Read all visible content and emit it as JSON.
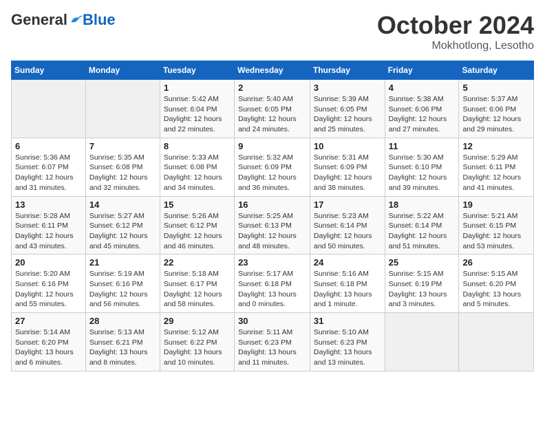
{
  "logo": {
    "general": "General",
    "blue": "Blue"
  },
  "header": {
    "month": "October 2024",
    "location": "Mokhotlong, Lesotho"
  },
  "weekdays": [
    "Sunday",
    "Monday",
    "Tuesday",
    "Wednesday",
    "Thursday",
    "Friday",
    "Saturday"
  ],
  "weeks": [
    [
      {
        "day": null
      },
      {
        "day": null
      },
      {
        "day": "1",
        "sunrise": "Sunrise: 5:42 AM",
        "sunset": "Sunset: 6:04 PM",
        "daylight": "Daylight: 12 hours and 22 minutes."
      },
      {
        "day": "2",
        "sunrise": "Sunrise: 5:40 AM",
        "sunset": "Sunset: 6:05 PM",
        "daylight": "Daylight: 12 hours and 24 minutes."
      },
      {
        "day": "3",
        "sunrise": "Sunrise: 5:39 AM",
        "sunset": "Sunset: 6:05 PM",
        "daylight": "Daylight: 12 hours and 25 minutes."
      },
      {
        "day": "4",
        "sunrise": "Sunrise: 5:38 AM",
        "sunset": "Sunset: 6:06 PM",
        "daylight": "Daylight: 12 hours and 27 minutes."
      },
      {
        "day": "5",
        "sunrise": "Sunrise: 5:37 AM",
        "sunset": "Sunset: 6:06 PM",
        "daylight": "Daylight: 12 hours and 29 minutes."
      }
    ],
    [
      {
        "day": "6",
        "sunrise": "Sunrise: 5:36 AM",
        "sunset": "Sunset: 6:07 PM",
        "daylight": "Daylight: 12 hours and 31 minutes."
      },
      {
        "day": "7",
        "sunrise": "Sunrise: 5:35 AM",
        "sunset": "Sunset: 6:08 PM",
        "daylight": "Daylight: 12 hours and 32 minutes."
      },
      {
        "day": "8",
        "sunrise": "Sunrise: 5:33 AM",
        "sunset": "Sunset: 6:08 PM",
        "daylight": "Daylight: 12 hours and 34 minutes."
      },
      {
        "day": "9",
        "sunrise": "Sunrise: 5:32 AM",
        "sunset": "Sunset: 6:09 PM",
        "daylight": "Daylight: 12 hours and 36 minutes."
      },
      {
        "day": "10",
        "sunrise": "Sunrise: 5:31 AM",
        "sunset": "Sunset: 6:09 PM",
        "daylight": "Daylight: 12 hours and 38 minutes."
      },
      {
        "day": "11",
        "sunrise": "Sunrise: 5:30 AM",
        "sunset": "Sunset: 6:10 PM",
        "daylight": "Daylight: 12 hours and 39 minutes."
      },
      {
        "day": "12",
        "sunrise": "Sunrise: 5:29 AM",
        "sunset": "Sunset: 6:11 PM",
        "daylight": "Daylight: 12 hours and 41 minutes."
      }
    ],
    [
      {
        "day": "13",
        "sunrise": "Sunrise: 5:28 AM",
        "sunset": "Sunset: 6:11 PM",
        "daylight": "Daylight: 12 hours and 43 minutes."
      },
      {
        "day": "14",
        "sunrise": "Sunrise: 5:27 AM",
        "sunset": "Sunset: 6:12 PM",
        "daylight": "Daylight: 12 hours and 45 minutes."
      },
      {
        "day": "15",
        "sunrise": "Sunrise: 5:26 AM",
        "sunset": "Sunset: 6:12 PM",
        "daylight": "Daylight: 12 hours and 46 minutes."
      },
      {
        "day": "16",
        "sunrise": "Sunrise: 5:25 AM",
        "sunset": "Sunset: 6:13 PM",
        "daylight": "Daylight: 12 hours and 48 minutes."
      },
      {
        "day": "17",
        "sunrise": "Sunrise: 5:23 AM",
        "sunset": "Sunset: 6:14 PM",
        "daylight": "Daylight: 12 hours and 50 minutes."
      },
      {
        "day": "18",
        "sunrise": "Sunrise: 5:22 AM",
        "sunset": "Sunset: 6:14 PM",
        "daylight": "Daylight: 12 hours and 51 minutes."
      },
      {
        "day": "19",
        "sunrise": "Sunrise: 5:21 AM",
        "sunset": "Sunset: 6:15 PM",
        "daylight": "Daylight: 12 hours and 53 minutes."
      }
    ],
    [
      {
        "day": "20",
        "sunrise": "Sunrise: 5:20 AM",
        "sunset": "Sunset: 6:16 PM",
        "daylight": "Daylight: 12 hours and 55 minutes."
      },
      {
        "day": "21",
        "sunrise": "Sunrise: 5:19 AM",
        "sunset": "Sunset: 6:16 PM",
        "daylight": "Daylight: 12 hours and 56 minutes."
      },
      {
        "day": "22",
        "sunrise": "Sunrise: 5:18 AM",
        "sunset": "Sunset: 6:17 PM",
        "daylight": "Daylight: 12 hours and 58 minutes."
      },
      {
        "day": "23",
        "sunrise": "Sunrise: 5:17 AM",
        "sunset": "Sunset: 6:18 PM",
        "daylight": "Daylight: 13 hours and 0 minutes."
      },
      {
        "day": "24",
        "sunrise": "Sunrise: 5:16 AM",
        "sunset": "Sunset: 6:18 PM",
        "daylight": "Daylight: 13 hours and 1 minute."
      },
      {
        "day": "25",
        "sunrise": "Sunrise: 5:15 AM",
        "sunset": "Sunset: 6:19 PM",
        "daylight": "Daylight: 13 hours and 3 minutes."
      },
      {
        "day": "26",
        "sunrise": "Sunrise: 5:15 AM",
        "sunset": "Sunset: 6:20 PM",
        "daylight": "Daylight: 13 hours and 5 minutes."
      }
    ],
    [
      {
        "day": "27",
        "sunrise": "Sunrise: 5:14 AM",
        "sunset": "Sunset: 6:20 PM",
        "daylight": "Daylight: 13 hours and 6 minutes."
      },
      {
        "day": "28",
        "sunrise": "Sunrise: 5:13 AM",
        "sunset": "Sunset: 6:21 PM",
        "daylight": "Daylight: 13 hours and 8 minutes."
      },
      {
        "day": "29",
        "sunrise": "Sunrise: 5:12 AM",
        "sunset": "Sunset: 6:22 PM",
        "daylight": "Daylight: 13 hours and 10 minutes."
      },
      {
        "day": "30",
        "sunrise": "Sunrise: 5:11 AM",
        "sunset": "Sunset: 6:23 PM",
        "daylight": "Daylight: 13 hours and 11 minutes."
      },
      {
        "day": "31",
        "sunrise": "Sunrise: 5:10 AM",
        "sunset": "Sunset: 6:23 PM",
        "daylight": "Daylight: 13 hours and 13 minutes."
      },
      {
        "day": null
      },
      {
        "day": null
      }
    ]
  ]
}
